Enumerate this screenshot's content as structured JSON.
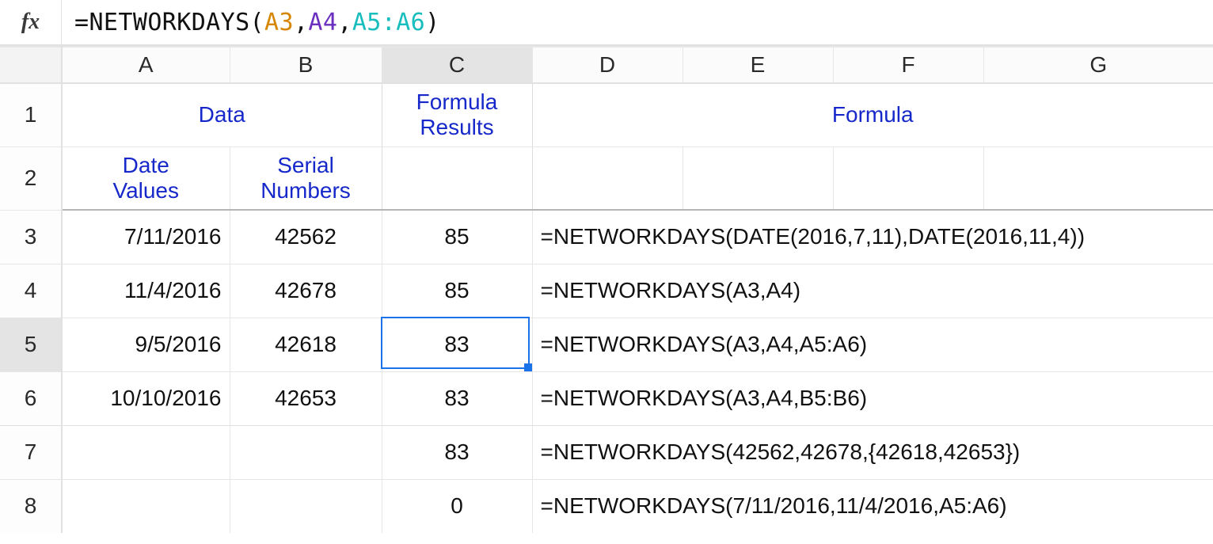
{
  "formula_bar": {
    "fx_label": "fx",
    "equals": "=",
    "fn": "NETWORKDAYS",
    "open": "(",
    "arg1": "A3",
    "sep1": ",",
    "arg2": "A4",
    "sep2": ",",
    "arg3": "A5:A6",
    "close": ")"
  },
  "columns": {
    "A": "A",
    "B": "B",
    "C": "C",
    "D": "D",
    "E": "E",
    "F": "F",
    "G": "G"
  },
  "row_nums": {
    "1": "1",
    "2": "2",
    "3": "3",
    "4": "4",
    "5": "5",
    "6": "6",
    "7": "7",
    "8": "8"
  },
  "headers": {
    "data": "Data",
    "formula_results_line1": "Formula",
    "formula_results_line2": "Results",
    "formula": "Formula",
    "date_values_line1": "Date",
    "date_values_line2": "Values",
    "serial_numbers_line1": "Serial",
    "serial_numbers_line2": "Numbers"
  },
  "rows": {
    "3": {
      "A": "7/11/2016",
      "B": "42562",
      "C": "85",
      "D": "=NETWORKDAYS(DATE(2016,7,11),DATE(2016,11,4))"
    },
    "4": {
      "A": "11/4/2016",
      "B": "42678",
      "C": "85",
      "D": "=NETWORKDAYS(A3,A4)"
    },
    "5": {
      "A": "9/5/2016",
      "B": "42618",
      "C": "83",
      "D": "=NETWORKDAYS(A3,A4,A5:A6)"
    },
    "6": {
      "A": "10/10/2016",
      "B": "42653",
      "C": "83",
      "D": "=NETWORKDAYS(A3,A4,B5:B6)"
    },
    "7": {
      "A": "",
      "B": "",
      "C": "83",
      "D": "=NETWORKDAYS(42562,42678,{42618,42653})"
    },
    "8": {
      "A": "",
      "B": "",
      "C": "0",
      "D": "=NETWORKDAYS(7/11/2016,11/4/2016,A5:A6)"
    }
  },
  "active_cell": "C5"
}
